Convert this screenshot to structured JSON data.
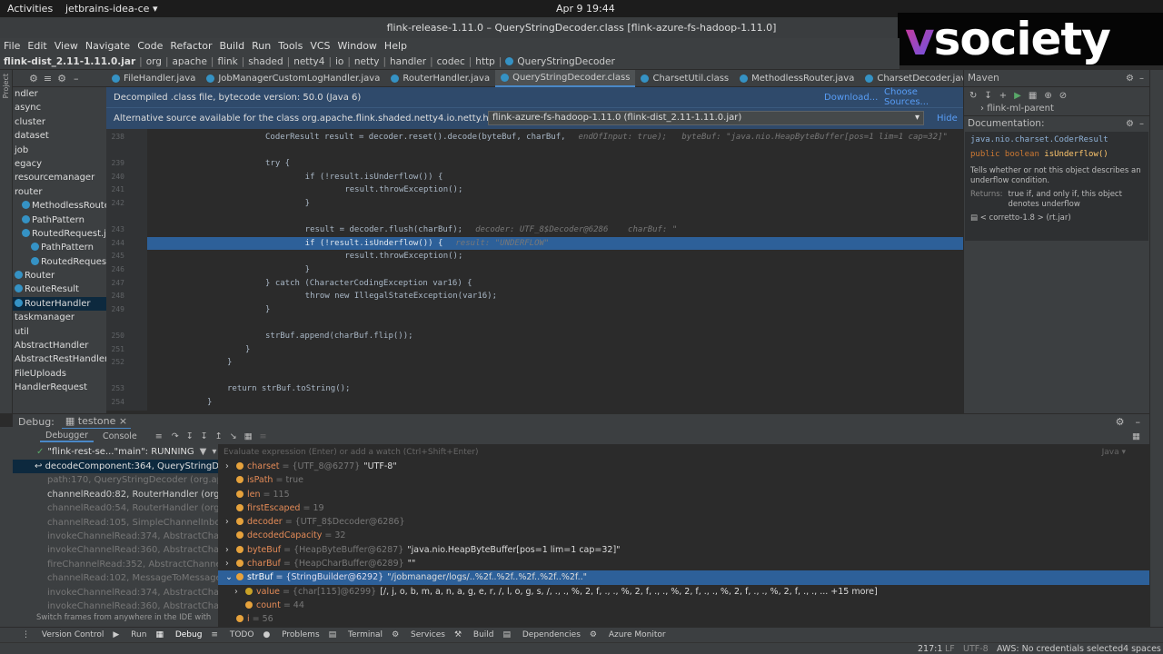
{
  "topbar": {
    "activities": "Activities",
    "app": "jetbrains-idea-ce ▾",
    "clock": "Apr 9  19:44"
  },
  "window": {
    "title": "flink-release-1.11.0 – QueryStringDecoder.class [flink-azure-fs-hadoop-1.11.0]"
  },
  "logo": {
    "v": "v",
    "text": "society"
  },
  "menu": [
    "File",
    "Edit",
    "View",
    "Navigate",
    "Code",
    "Refactor",
    "Build",
    "Run",
    "Tools",
    "VCS",
    "Window",
    "Help"
  ],
  "breadcrumb": [
    "flink-dist_2.11-1.11.0.jar",
    "org",
    "apache",
    "flink",
    "shaded",
    "netty4",
    "io",
    "netty",
    "handler",
    "codec",
    "http",
    "QueryStringDecoder"
  ],
  "project": {
    "stripe_label": "Project",
    "items": [
      "ndler",
      "async",
      "cluster",
      "dataset",
      "job",
      "egacy",
      "resourcemanager",
      "router",
      "MethodlessRouter",
      "PathPattern",
      "RoutedRequest.java",
      "PathPattern",
      "RoutedRequest",
      "Router",
      "RouteResult",
      "RouterHandler",
      "taskmanager",
      "util",
      "AbstractHandler",
      "AbstractRestHandler",
      "FileUploads",
      "HandlerRequest"
    ]
  },
  "tabs": [
    "FileHandler.java",
    "JobManagerCustomLogHandler.java",
    "RouterHandler.java",
    "QueryStringDecoder.class",
    "CharsetUtil.class",
    "MethodlessRouter.java",
    "CharsetDecoder.jav"
  ],
  "notice1": {
    "text": "Decompiled .class file, bytecode version: 50.0 (Java 6)",
    "download": "Download...",
    "choose": "Choose Sources..."
  },
  "notice2": {
    "text": "Alternative source available for the class org.apache.flink.shaded.netty4.io.netty.handler.cod...",
    "select": "flink-azure-fs-hadoop-1.11.0 (flink-dist_2.11-1.11.0.jar)",
    "hide": "Hide"
  },
  "editor": {
    "lines": [
      {
        "n": "238",
        "code": "CoderResult result = decoder.reset().decode(byteBuf, charBuf,",
        "hint": "endOfInput: true);   byteBuf: \"java.nio.HeapByteBuffer[pos=1 lim=1 cap=32]\"   result"
      },
      {
        "n": "",
        "code": "",
        "hint": ""
      },
      {
        "n": "239",
        "code": "try {",
        "hint": ""
      },
      {
        "n": "240",
        "code": "    if (!result.isUnderflow()) {",
        "hint": ""
      },
      {
        "n": "241",
        "code": "        result.throwException();",
        "hint": ""
      },
      {
        "n": "242",
        "code": "    }",
        "hint": ""
      },
      {
        "n": "",
        "code": "",
        "hint": ""
      },
      {
        "n": "243",
        "code": "    result = decoder.flush(charBuf);",
        "hint": "decoder: UTF_8$Decoder@6286    charBuf: \""
      },
      {
        "n": "244",
        "code": "    if (!result.isUnderflow()) {",
        "hint": "result: \"UNDERFLOW\""
      },
      {
        "n": "245",
        "code": "        result.throwException();",
        "hint": ""
      },
      {
        "n": "246",
        "code": "    }",
        "hint": ""
      },
      {
        "n": "247",
        "code": "} catch (CharacterCodingException var16) {",
        "hint": ""
      },
      {
        "n": "248",
        "code": "    throw new IllegalStateException(var16);",
        "hint": ""
      },
      {
        "n": "249",
        "code": "}",
        "hint": ""
      },
      {
        "n": "",
        "code": "",
        "hint": ""
      },
      {
        "n": "250",
        "code": "strBuf.append(charBuf.flip());",
        "hint": ""
      },
      {
        "n": "251",
        "code": "}",
        "hint": ""
      },
      {
        "n": "252",
        "code": "}",
        "hint": ""
      },
      {
        "n": "",
        "code": "",
        "hint": ""
      },
      {
        "n": "253",
        "code": "return strBuf.toString();",
        "hint": ""
      },
      {
        "n": "254",
        "code": "}",
        "hint": ""
      }
    ]
  },
  "maven": {
    "title": "Maven",
    "tree_item": "flink-ml-parent",
    "doc_title": "Documentation:",
    "doc_class": "java.nio.charset.CoderResult",
    "doc_sig_kw": "public boolean",
    "doc_sig_name": "isUnderflow()",
    "doc_desc": "Tells whether or not this object describes an underflow condition.",
    "doc_returns_label": "Returns:",
    "doc_returns": "true if, and only if, this object denotes underflow",
    "doc_source": "< corretto-1.8 > (rt.jar)"
  },
  "debug": {
    "label": "Debug:",
    "config": "testone",
    "tab_debugger": "Debugger",
    "tab_console": "Console",
    "thread": "\"flink-rest-se...\"main\": RUNNING",
    "eval_placeholder": "Evaluate expression (Enter) or add a watch (Ctrl+Shift+Enter)",
    "lang": "Java ▾",
    "frames": [
      "decodeComponent:364, QueryStringDecod",
      "path:170, QueryStringDecoder (org.apach",
      "channelRead0:82, RouterHandler (org.apa",
      "channelRead0:54, RouterHandler (org.apa",
      "channelRead:105, SimpleChannelInbound",
      "invokeChannelRead:374, AbstractChann",
      "invokeChannelRead:360, AbstractChann",
      "fireChannelRead:352, AbstractChannelH",
      "channelRead:102, MessageToMessageDe",
      "invokeChannelRead:374, AbstractChann",
      "invokeChannelRead:360, AbstractChann"
    ],
    "switch_hint": "Switch frames from anywhere in the IDE with ...",
    "variables": [
      {
        "name": "charset",
        "type": "= {UTF_8@6277}",
        "value": "\"UTF-8\""
      },
      {
        "name": "isPath",
        "type": "= true",
        "value": ""
      },
      {
        "name": "len",
        "type": "= 115",
        "value": ""
      },
      {
        "name": "firstEscaped",
        "type": "= 19",
        "value": ""
      },
      {
        "name": "decoder",
        "type": "= {UTF_8$Decoder@6286}",
        "value": ""
      },
      {
        "name": "decodedCapacity",
        "type": "= 32",
        "value": ""
      },
      {
        "name": "byteBuf",
        "type": "= {HeapByteBuffer@6287}",
        "value": "\"java.nio.HeapByteBuffer[pos=1 lim=1 cap=32]\""
      },
      {
        "name": "charBuf",
        "type": "= {HeapCharBuffer@6289}",
        "value": "\"\""
      },
      {
        "name": "strBuf",
        "type": "= {StringBuilder@6292}",
        "value": "\"/jobmanager/logs/..%2f..%2f..%2f..%2f..%2f..\""
      },
      {
        "name": "value",
        "type": "= {char[115]@6299}",
        "value": "[/, j, o, b, m, a, n, a, g, e, r, /, l, o, g, s, /, ., ., %, 2, f, ., ., %, 2, f, ., ., %, 2, f, ., ., %, 2, f, ., ., %, 2, f, ., ., ...   +15 more]"
      },
      {
        "name": "count",
        "type": "= 44",
        "value": ""
      },
      {
        "name": "i",
        "type": "= 56",
        "value": ""
      }
    ]
  },
  "toolwindows": [
    "Version Control",
    "Run",
    "Debug",
    "TODO",
    "Problems",
    "Terminal",
    "Services",
    "Build",
    "Dependencies",
    "Azure Monitor"
  ],
  "status": {
    "pos": "217:1",
    "lf": "LF",
    "enc": "UTF-8",
    "aws": "AWS: No credentials selected",
    "indent": "4 spaces"
  }
}
